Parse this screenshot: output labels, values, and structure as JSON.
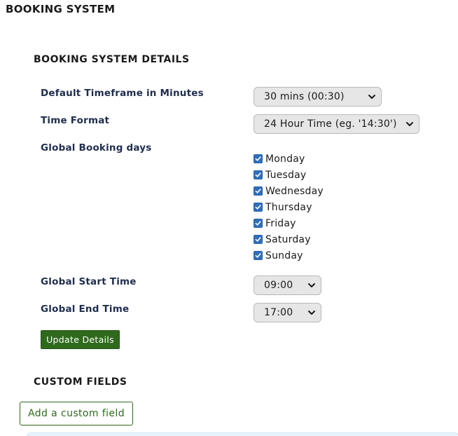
{
  "page": {
    "title": "BOOKING SYSTEM"
  },
  "details": {
    "heading": "BOOKING SYSTEM DETAILS",
    "timeframe": {
      "label": "Default Timeframe in Minutes",
      "selected": "30 mins (00:30)"
    },
    "time_format": {
      "label": "Time Format",
      "selected": "24 Hour Time (eg. '14:30')"
    },
    "booking_days": {
      "label": "Global Booking days",
      "days": [
        {
          "label": "Monday",
          "checked": true
        },
        {
          "label": "Tuesday",
          "checked": true
        },
        {
          "label": "Wednesday",
          "checked": true
        },
        {
          "label": "Thursday",
          "checked": true
        },
        {
          "label": "Friday",
          "checked": true
        },
        {
          "label": "Saturday",
          "checked": true
        },
        {
          "label": "Sunday",
          "checked": true
        }
      ]
    },
    "start_time": {
      "label": "Global Start Time",
      "selected": "09:00"
    },
    "end_time": {
      "label": "Global End Time",
      "selected": "17:00"
    },
    "update_button": "Update Details"
  },
  "custom_fields": {
    "heading": "CUSTOM FIELDS",
    "add_button": "Add a custom field"
  },
  "colors": {
    "primary_green": "#2e6a1c",
    "checkbox_blue": "#2f6fbd",
    "label_navy": "#1f2d4d",
    "select_bg": "#e6e6e6",
    "info_bg": "#e7f3fb"
  },
  "icons": {
    "select_chevron": "chevron-down-icon",
    "checkbox_check": "check-icon"
  }
}
